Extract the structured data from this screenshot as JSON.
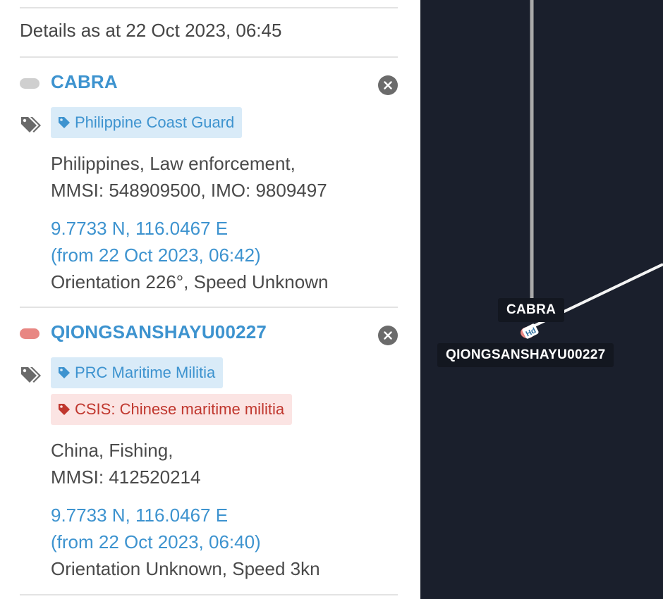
{
  "panel": {
    "details_as_at": "Details as at 22 Oct 2023, 06:45"
  },
  "vessels": [
    {
      "name": "CABRA",
      "marker_color": "#cfcfcf",
      "tags": [
        {
          "label": "Philippine Coast Guard",
          "style": "blue"
        }
      ],
      "info_line_1": "Philippines, Law enforcement,",
      "info_line_2": "MMSI: 548909500, IMO: 9809497",
      "position": "9.7733 N, 116.0467 E",
      "position_time": "(from 22 Oct 2023, 06:42)",
      "motion": "Orientation 226°, Speed Unknown"
    },
    {
      "name": "QIONGSANSHAYU00227",
      "marker_color": "#e88783",
      "tags": [
        {
          "label": "PRC Maritime Militia",
          "style": "blue"
        },
        {
          "label": "CSIS: Chinese maritime militia",
          "style": "red"
        }
      ],
      "info_line_1": "China, Fishing,",
      "info_line_2": "MMSI: 412520214",
      "position": "9.7733 N, 116.0467 E",
      "position_time": "(from 22 Oct 2023, 06:40)",
      "motion": "Orientation Unknown, Speed 3kn"
    }
  ],
  "map": {
    "labels": {
      "cabra": "CABRA",
      "qiong": "QIONGSANSHAYU00227"
    },
    "marker_glyph": "Hd",
    "background": "#1a1f2c"
  },
  "icons": {
    "close": "close-icon",
    "tags": "tags-icon",
    "tag": "tag-icon",
    "vessel_marker": "vessel-marker-icon"
  }
}
